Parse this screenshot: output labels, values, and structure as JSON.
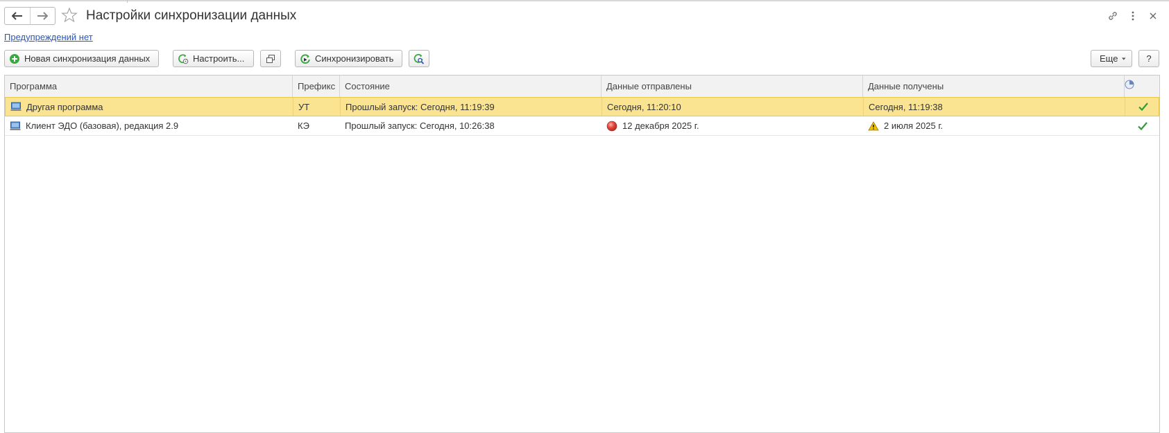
{
  "window": {
    "title": "Настройки синхронизации данных"
  },
  "notice": {
    "link_text": "Предупреждений нет"
  },
  "toolbar": {
    "new_sync": "Новая синхронизация данных",
    "configure": "Настроить...",
    "synchronize": "Синхронизировать",
    "more": "Еще",
    "help": "?"
  },
  "table": {
    "headers": [
      "Программа",
      "Префикс",
      "Состояние",
      "Данные отправлены",
      "Данные получены"
    ],
    "rows": [
      {
        "program": "Другая программа",
        "prefix": "УТ",
        "state": "Прошлый запуск: Сегодня, 11:19:39",
        "sent": "Сегодня, 11:20:10",
        "received": "Сегодня, 11:19:38",
        "selected": true
      },
      {
        "program": "Клиент ЭДО (базовая), редакция 2.9",
        "prefix": "КЭ",
        "state": "Прошлый запуск: Сегодня, 10:26:38",
        "sent": "12 декабря 2025 г.",
        "received": "2 июля 2025 г.",
        "sent_status_icon": "red-circle-error-icon",
        "received_status_icon": "warning-triangle-icon",
        "selected": false
      }
    ]
  },
  "colors": {
    "selected_row": "#fbe491",
    "link": "#2a56b8",
    "success": "#2e9b34",
    "error": "#e0443a",
    "warning": "#f2c200"
  }
}
